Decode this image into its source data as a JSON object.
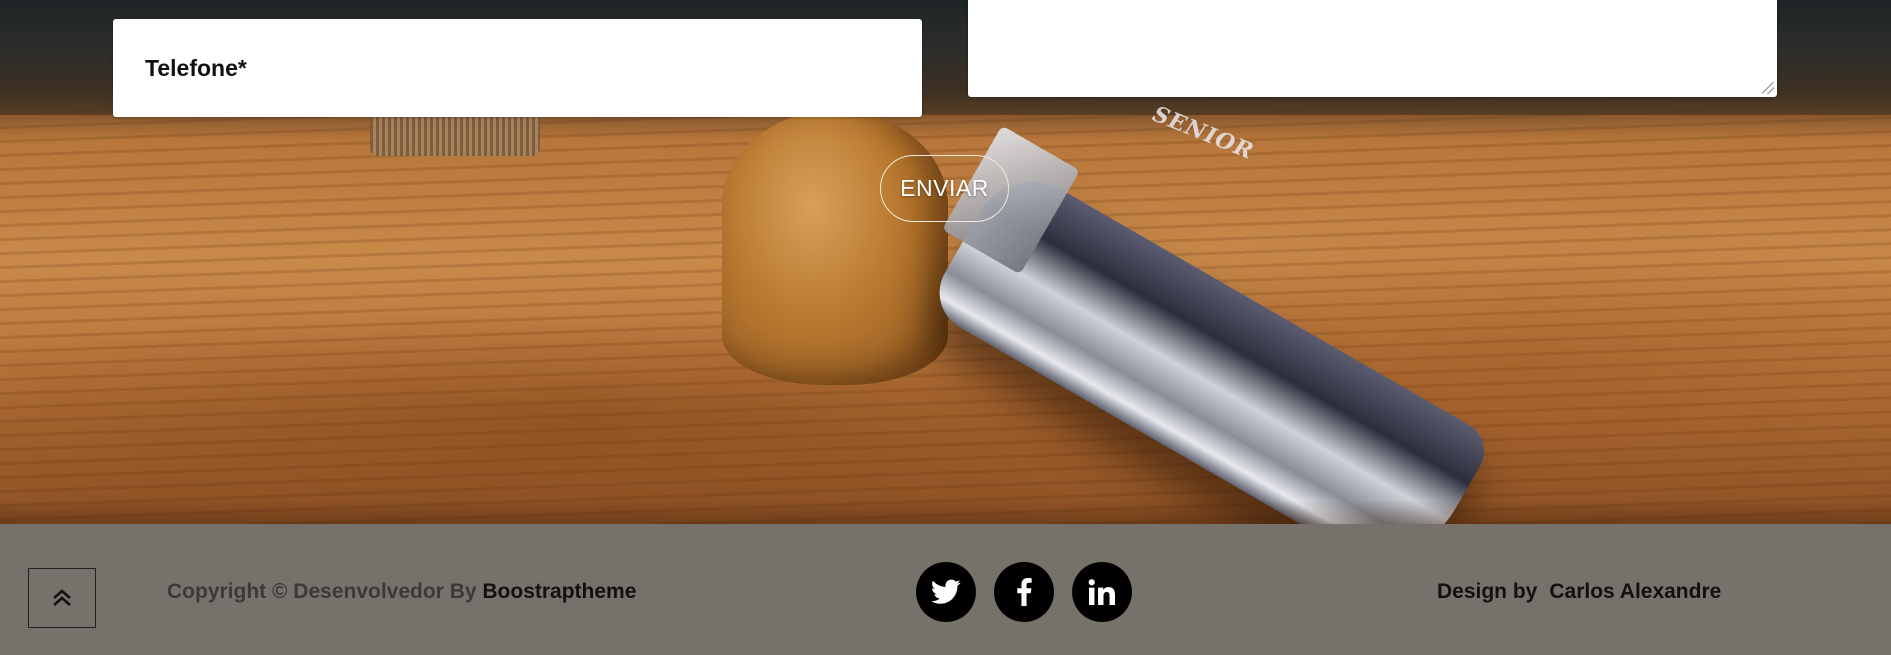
{
  "form": {
    "phone_placeholder": "Telefone*",
    "submit_label": "ENVIAR"
  },
  "scene": {
    "clipper_brand": "SENIOR"
  },
  "footer": {
    "back_to_top_icon": "double-chevron-up-icon",
    "copyright_prefix": "Copyright © Desenvolvedor By ",
    "copyright_link": "Boostraptheme",
    "socials": [
      {
        "name": "twitter-icon"
      },
      {
        "name": "facebook-icon"
      },
      {
        "name": "linkedin-icon"
      }
    ],
    "design_label": "Design by",
    "designer_name": "Carlos Alexandre",
    "background_color": "#77716c"
  }
}
